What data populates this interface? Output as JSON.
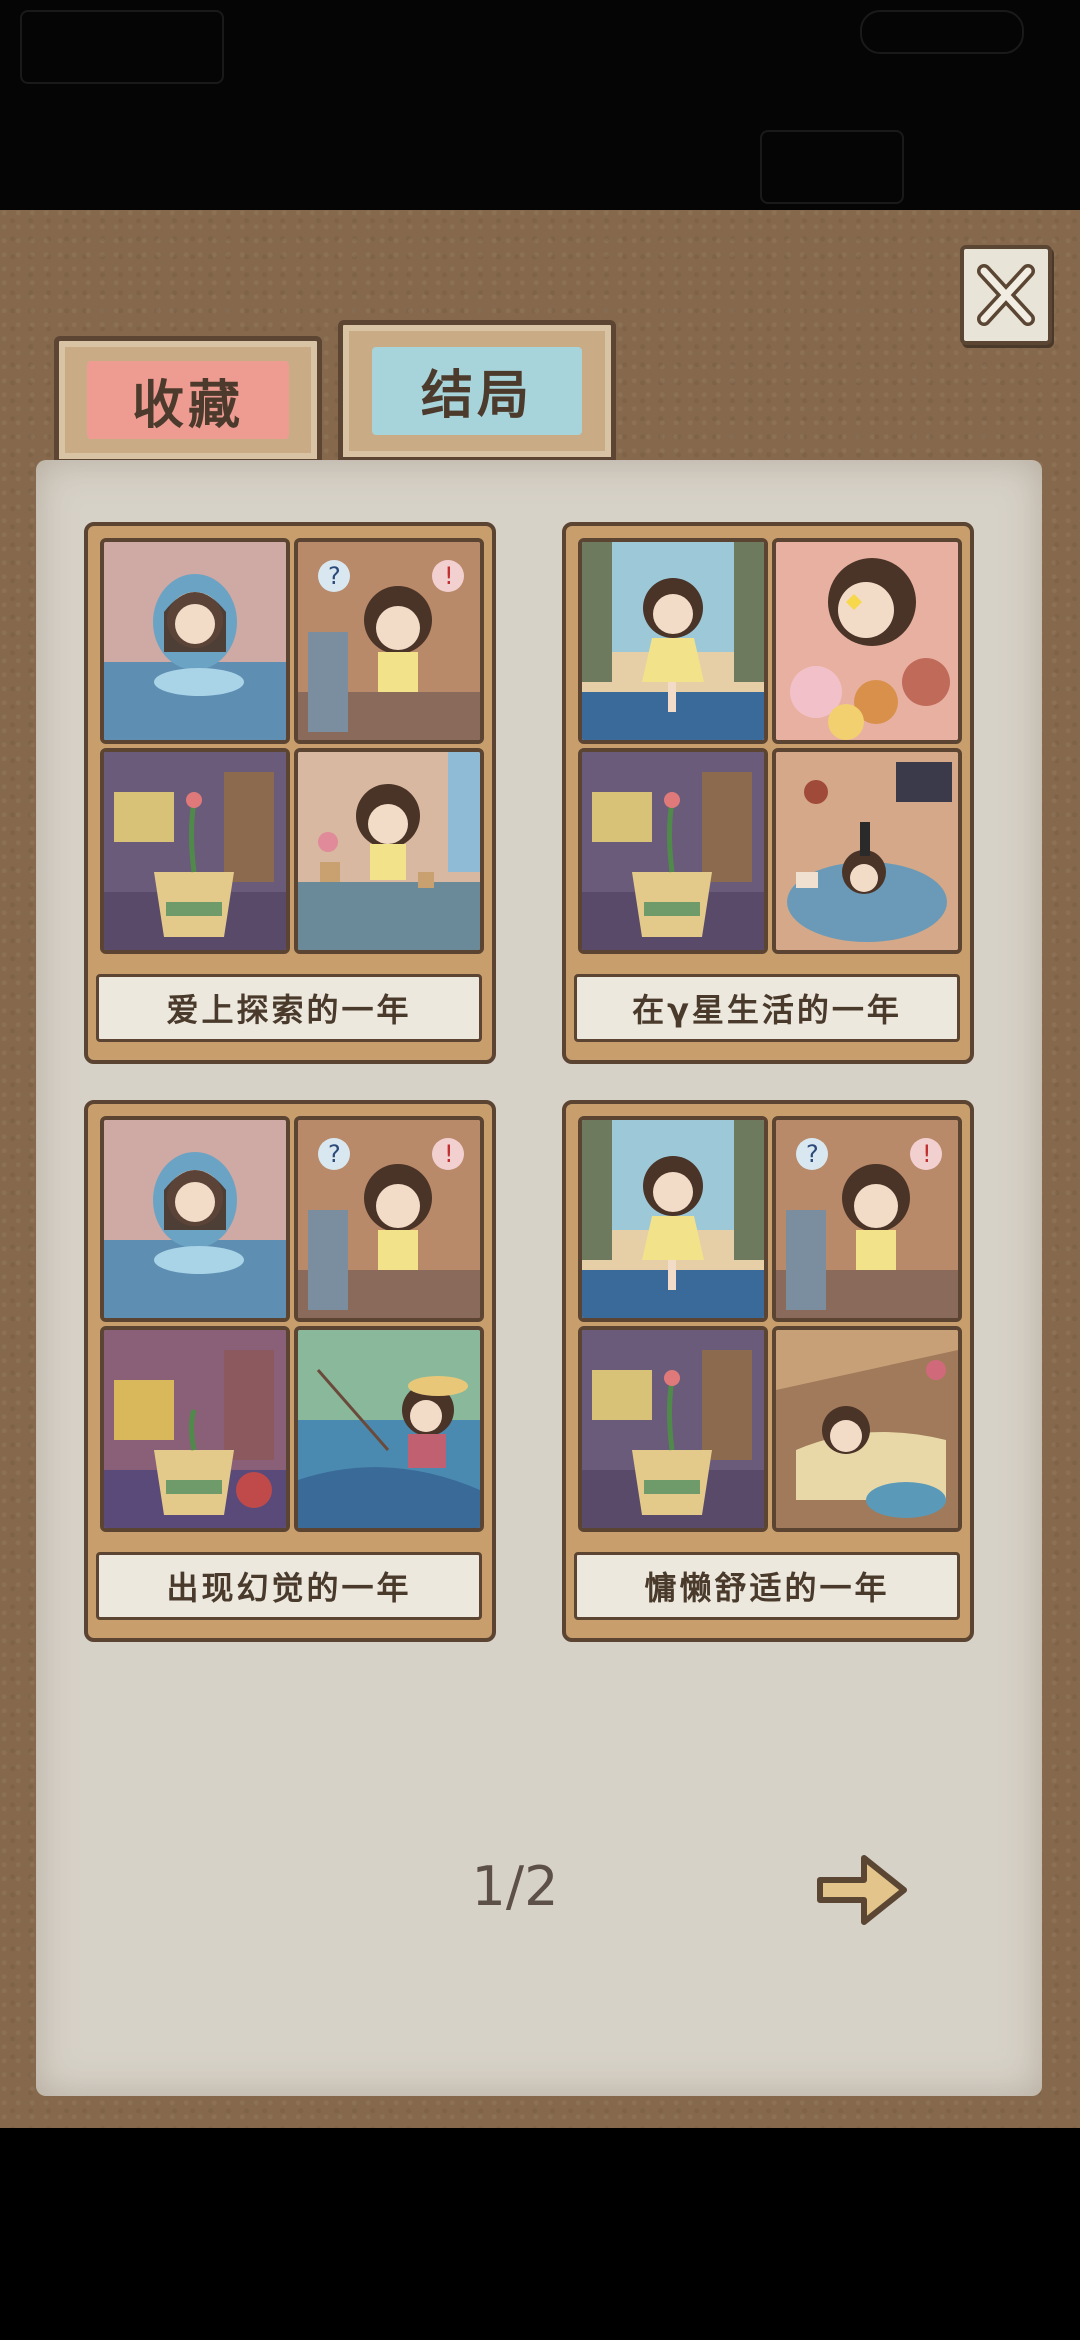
{
  "tabs": [
    {
      "label": "收藏",
      "active": false
    },
    {
      "label": "结局",
      "active": true
    }
  ],
  "endings": [
    {
      "title": "爱上探索的一年"
    },
    {
      "title": "在γ星生活的一年"
    },
    {
      "title": "出现幻觉的一年"
    },
    {
      "title": "慵懒舒适的一年"
    }
  ],
  "pagination": {
    "text": "1/2"
  },
  "icons": {
    "close": "close-icon",
    "next": "arrow-right-icon"
  },
  "colors": {
    "board": "#86694c",
    "paper": "#d7d2c8",
    "tab_collect": "#ee9b92",
    "tab_ending": "#a7d3da"
  }
}
